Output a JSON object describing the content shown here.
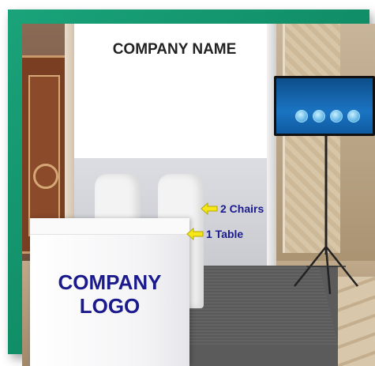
{
  "booth": {
    "company_name": "COMPANY NAME",
    "company_logo_line1": "COMPANY",
    "company_logo_line2": "LOGO"
  },
  "callouts": {
    "chairs": "2 Chairs",
    "table": "1 Table"
  },
  "colors": {
    "frame": "#0e8a63",
    "label_text": "#1a1a8c",
    "arrow_fill": "#f5e61a"
  }
}
